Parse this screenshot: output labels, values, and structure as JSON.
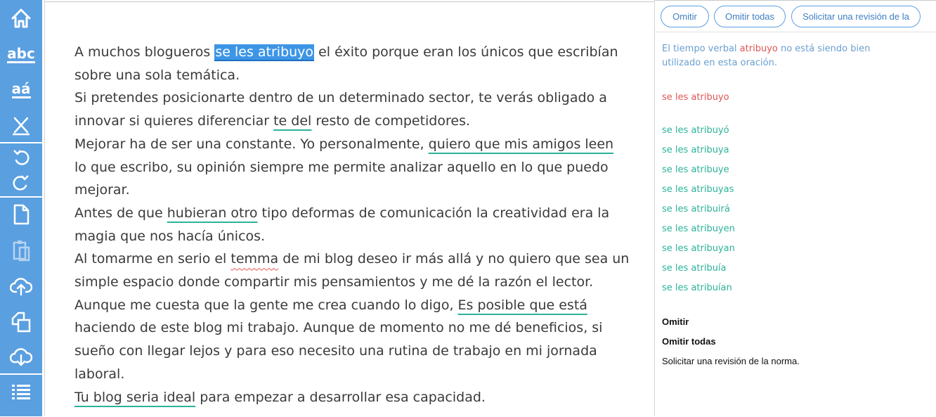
{
  "sidebar": {
    "icons": [
      "home-icon",
      "spell-check-icon",
      "accent-check-icon",
      "clear-format-icon",
      "undo-icon",
      "redo-icon",
      "new-document-icon",
      "paste-icon",
      "upload-icon",
      "copy-icon",
      "download-icon",
      "list-icon"
    ],
    "spell_label": "abc",
    "accent_label": "aá"
  },
  "document": {
    "p1": {
      "pre": "A muchos blogueros ",
      "hl": "se les atribuyo",
      "post": " el éxito porque eran los únicos que escribían sobre una sola temática."
    },
    "p2": {
      "pre": "Si pretendes posicionarte dentro de un determinado sector, te verás obligado a innovar si quieres diferenciar ",
      "u1": "te del",
      "post": " resto de competidores."
    },
    "p3": {
      "pre": "Mejorar ha de ser una constante. Yo personalmente, ",
      "u1": "quiero que mis amigos leen",
      "post": " lo que escribo, su opinión siempre me permite analizar aquello en lo que puedo mejorar."
    },
    "p4": {
      "pre": "Antes de que ",
      "u1": "hubieran otro",
      "post": " tipo deformas de comunicación la creatividad era la magia que nos hacía únicos."
    },
    "p5": {
      "pre": "Al tomarme en serio el ",
      "u1": "temma",
      "post": " de mi blog deseo ir más allá y no quiero que sea un simple espacio donde compartir mis pensamientos y me dé la razón el lector."
    },
    "p6": {
      "pre": "Aunque me cuesta que la gente me crea cuando lo digo, ",
      "u1": "Es posible que está",
      "post": " haciendo de este blog mi trabajo. Aunque de momento no me dé beneficios, si sueño con llegar lejos y para eso necesito una rutina de trabajo en mi jornada laboral."
    },
    "p7": {
      "u1": "Tu blog seria ideal",
      "post": " para empezar a desarrollar esa capacidad."
    }
  },
  "panel": {
    "buttons": {
      "skip": "Omitir",
      "skip_all": "Omitir todas",
      "request_review": "Solicitar una revisión de la"
    },
    "message": {
      "pre": "El tiempo verbal ",
      "word": "atribuyo",
      "post": " no está siendo bien utilizado en esta oración."
    },
    "original": "se les atribuyo",
    "suggestions": [
      "se les atribuyó",
      "se les atribuya",
      "se les atribuye",
      "se les atribuyas",
      "se les atribuirá",
      "se les atribuyen",
      "se les atribuyan",
      "se les atribuía",
      "se les atribuían"
    ],
    "actions": {
      "skip": "Omitir",
      "skip_all": "Omitir todas",
      "request_review": "Solicitar una revisión de la norma."
    }
  },
  "colors": {
    "sidebar": "#5a9fe0",
    "highlight": "#3d95e6",
    "grammar_underline": "#2cb39a",
    "spelling_underline": "#e05555",
    "message_text": "#6a9fd0"
  }
}
